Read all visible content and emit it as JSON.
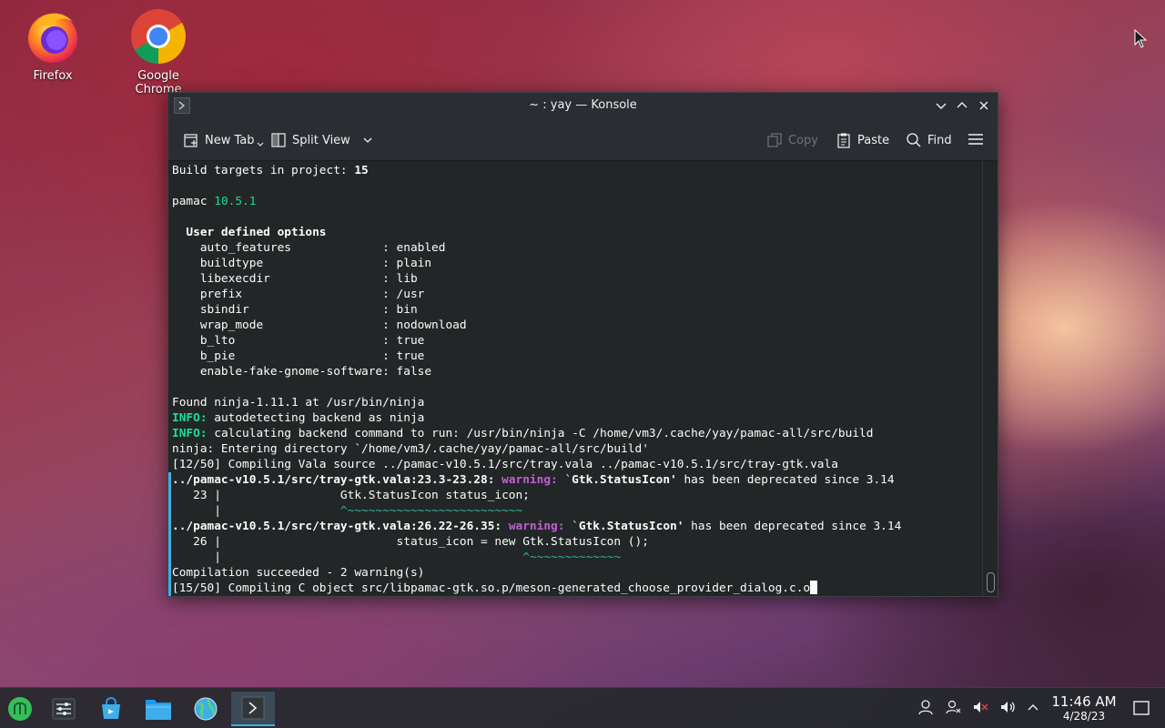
{
  "desktop": {
    "icons": [
      {
        "label": "Firefox",
        "icon": "firefox-icon"
      },
      {
        "label": "Google Chrome",
        "icon": "chrome-icon"
      }
    ]
  },
  "window": {
    "title": "~ : yay — Konsole",
    "toolbar": {
      "new_tab": "New Tab",
      "split_view": "Split View",
      "copy": "Copy",
      "paste": "Paste",
      "find": "Find"
    }
  },
  "terminal": {
    "lines": [
      {
        "spans": [
          {
            "t": "Build targets in project: "
          },
          {
            "t": "15",
            "c": "b"
          }
        ]
      },
      {
        "spans": [
          {
            "t": ""
          }
        ]
      },
      {
        "spans": [
          {
            "t": "pamac "
          },
          {
            "t": "10.5.1",
            "c": "g"
          }
        ]
      },
      {
        "spans": [
          {
            "t": ""
          }
        ]
      },
      {
        "spans": [
          {
            "t": "  User defined options",
            "c": "b"
          }
        ]
      },
      {
        "spans": [
          {
            "t": "    auto_features             : enabled"
          }
        ]
      },
      {
        "spans": [
          {
            "t": "    buildtype                 : plain"
          }
        ]
      },
      {
        "spans": [
          {
            "t": "    libexecdir                : lib"
          }
        ]
      },
      {
        "spans": [
          {
            "t": "    prefix                    : /usr"
          }
        ]
      },
      {
        "spans": [
          {
            "t": "    sbindir                   : bin"
          }
        ]
      },
      {
        "spans": [
          {
            "t": "    wrap_mode                 : nodownload"
          }
        ]
      },
      {
        "spans": [
          {
            "t": "    b_lto                     : true"
          }
        ]
      },
      {
        "spans": [
          {
            "t": "    b_pie                     : true"
          }
        ]
      },
      {
        "spans": [
          {
            "t": "    enable-fake-gnome-software: false"
          }
        ]
      },
      {
        "spans": [
          {
            "t": ""
          }
        ]
      },
      {
        "spans": [
          {
            "t": "Found ninja-1.11.1 at /usr/bin/ninja"
          }
        ]
      },
      {
        "spans": [
          {
            "t": "INFO:",
            "c": "g b"
          },
          {
            "t": " autodetecting backend as ninja"
          }
        ]
      },
      {
        "spans": [
          {
            "t": "INFO:",
            "c": "g b"
          },
          {
            "t": " calculating backend command to run: /usr/bin/ninja -C /home/vm3/.cache/yay/pamac-all/src/build"
          }
        ]
      },
      {
        "spans": [
          {
            "t": "ninja: Entering directory `/home/vm3/.cache/yay/pamac-all/src/build'"
          }
        ]
      },
      {
        "spans": [
          {
            "t": "[12/50] Compiling Vala source ../pamac-v10.5.1/src/tray.vala ../pamac-v10.5.1/src/tray-gtk.vala"
          }
        ]
      },
      {
        "spans": [
          {
            "t": "../pamac-v10.5.1/src/tray-gtk.vala:23.3-23.28: ",
            "c": "b"
          },
          {
            "t": "warning:",
            "c": "mag"
          },
          {
            "t": " `"
          },
          {
            "t": "Gtk.StatusIcon'",
            "c": "b"
          },
          {
            "t": " has been deprecated since 3.14"
          }
        ]
      },
      {
        "spans": [
          {
            "t": "   23 |                 Gtk.StatusIcon status_icon;"
          }
        ]
      },
      {
        "spans": [
          {
            "t": "      |                 "
          },
          {
            "t": "^~~~~~~~~~~~~~~~~~~~~~~~~~",
            "c": "teal"
          }
        ]
      },
      {
        "spans": [
          {
            "t": "../pamac-v10.5.1/src/tray-gtk.vala:26.22-26.35: ",
            "c": "b"
          },
          {
            "t": "warning:",
            "c": "mag"
          },
          {
            "t": " `"
          },
          {
            "t": "Gtk.StatusIcon'",
            "c": "b"
          },
          {
            "t": " has been deprecated since 3.14"
          }
        ]
      },
      {
        "spans": [
          {
            "t": "   26 |                         status_icon = new Gtk.StatusIcon ();"
          }
        ]
      },
      {
        "spans": [
          {
            "t": "      |                                           "
          },
          {
            "t": "^~~~~~~~~~~~~~",
            "c": "teal"
          }
        ]
      },
      {
        "spans": [
          {
            "t": "Compilation succeeded - 2 warning(s)"
          }
        ]
      },
      {
        "spans": [
          {
            "t": "[15/50] Compiling C object src/libpamac-gtk.so.p/meson-generated_choose_provider_dialog.c.o"
          }
        ],
        "cursor": true
      }
    ]
  },
  "taskbar": {
    "apps": [
      {
        "icon": "application-launcher-icon"
      },
      {
        "icon": "system-settings-icon"
      },
      {
        "icon": "discover-store-icon"
      },
      {
        "icon": "dolphin-folder-icon"
      },
      {
        "icon": "network-globe-icon"
      },
      {
        "icon": "konsole-terminal-icon",
        "active": true
      }
    ],
    "clock": {
      "time": "11:46 AM",
      "date": "4/28/23"
    }
  }
}
